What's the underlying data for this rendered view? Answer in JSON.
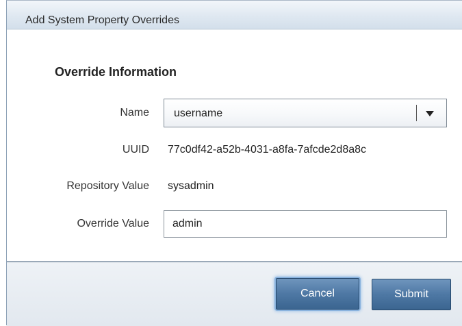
{
  "dialog": {
    "title": "Add System Property Overrides",
    "section_title": "Override Information"
  },
  "form": {
    "name_label": "Name",
    "name_value": "username",
    "uuid_label": "UUID",
    "uuid_value": "77c0df42-a52b-4031-a8fa-7afcde2d8a8c",
    "repo_label": "Repository Value",
    "repo_value": "sysadmin",
    "override_label": "Override Value",
    "override_value": "admin"
  },
  "buttons": {
    "cancel": "Cancel",
    "submit": "Submit"
  },
  "icons": {
    "dropdown": "chevron-down-icon"
  },
  "colors": {
    "button_primary": "#4e78a4",
    "title_bar": "#dfe8f1",
    "focus_ring": "#8ab3de"
  }
}
